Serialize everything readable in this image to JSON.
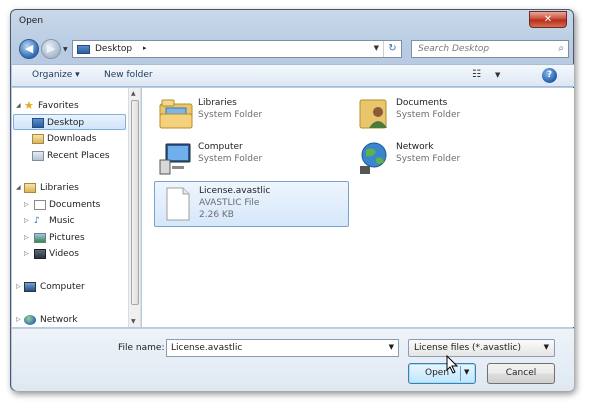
{
  "window": {
    "title": "Open",
    "close_glyph": "✕"
  },
  "nav": {
    "back_icon": "back-arrow-icon",
    "back_glyph": "◀",
    "forward_glyph": "▶",
    "address": "Desktop",
    "address_separator": "▸",
    "search_placeholder": "Search Desktop",
    "refresh_glyph": "↻",
    "search_glyph": "⌕"
  },
  "toolbar": {
    "organize": "Organize ▾",
    "new_folder": "New folder",
    "view_glyph": "☷",
    "help_glyph": "?"
  },
  "navpane": {
    "favorites": "Favorites",
    "desktop": "Desktop",
    "downloads": "Downloads",
    "recent_places": "Recent Places",
    "libraries": "Libraries",
    "documents": "Documents",
    "music": "Music",
    "pictures": "Pictures",
    "videos": "Videos",
    "computer": "Computer",
    "network": "Network"
  },
  "items": [
    {
      "name": "Libraries",
      "type": "System Folder",
      "size": ""
    },
    {
      "name": "Documents",
      "type": "System Folder",
      "size": ""
    },
    {
      "name": "Computer",
      "type": "System Folder",
      "size": ""
    },
    {
      "name": "Network",
      "type": "System Folder",
      "size": ""
    },
    {
      "name": "License.avastlic",
      "type": "AVASTLIC File",
      "size": "2.26 KB"
    }
  ],
  "bottom": {
    "file_name_label": "File name:",
    "file_name_value": "License.avastlic",
    "file_type": "License files (*.avastlic)",
    "open_label": "Open",
    "cancel_label": "Cancel"
  },
  "colors": {
    "accent": "#3c7fb1",
    "selection": "#cfe5fb",
    "window_frame": "#b8cbe2",
    "close_button": "#c7432e"
  }
}
